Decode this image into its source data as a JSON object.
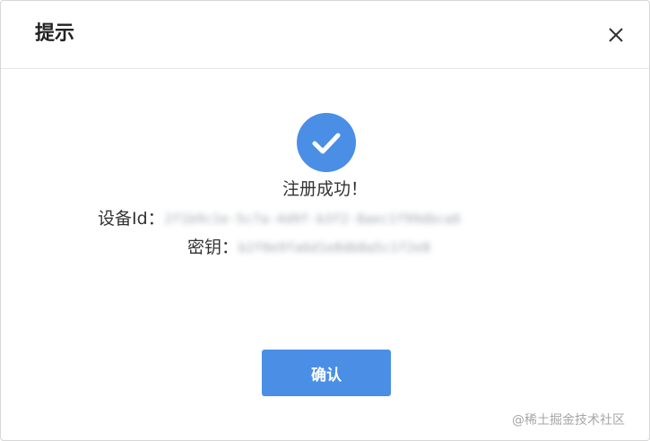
{
  "dialog": {
    "title": "提示",
    "close_icon": "close-icon",
    "success_icon": "check-circle-icon",
    "message": "注册成功！",
    "device_id_label": "设备Id：",
    "device_id_value": "2f1b9c1e-5c7a-4d9f-b3f2-8aec1f99dbca6",
    "secret_label": "密钥：",
    "secret_value": "b2f0e9fa6d1e8db8a5c1f2e8",
    "confirm_label": "确认"
  },
  "watermark": "@稀土掘金技术社区",
  "colors": {
    "accent": "#4a8ee6",
    "text": "#333333",
    "border": "#d6d6d6"
  }
}
